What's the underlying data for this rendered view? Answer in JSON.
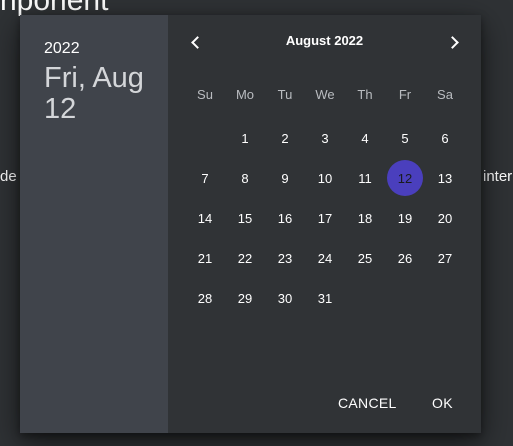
{
  "background": {
    "heading": "nponent",
    "text_left": "de t",
    "text_right": "inter"
  },
  "picker": {
    "year": "2022",
    "selected_date": "Fri, Aug 12",
    "month_label": "August 2022",
    "weekdays": [
      "Su",
      "Mo",
      "Tu",
      "We",
      "Th",
      "Fr",
      "Sa"
    ],
    "weeks": [
      [
        "",
        "1",
        "2",
        "3",
        "4",
        "5",
        "6"
      ],
      [
        "7",
        "8",
        "9",
        "10",
        "11",
        "12",
        "13"
      ],
      [
        "14",
        "15",
        "16",
        "17",
        "18",
        "19",
        "20"
      ],
      [
        "21",
        "22",
        "23",
        "24",
        "25",
        "26",
        "27"
      ],
      [
        "28",
        "29",
        "30",
        "31",
        "",
        "",
        ""
      ]
    ],
    "selected_day": "12",
    "cancel_label": "CANCEL",
    "ok_label": "OK"
  },
  "colors": {
    "accent": "#4a3fbd",
    "sidebar": "#40444b",
    "surface": "#303336"
  },
  "icons": {
    "prev": "chevron-left-icon",
    "next": "chevron-right-icon"
  }
}
